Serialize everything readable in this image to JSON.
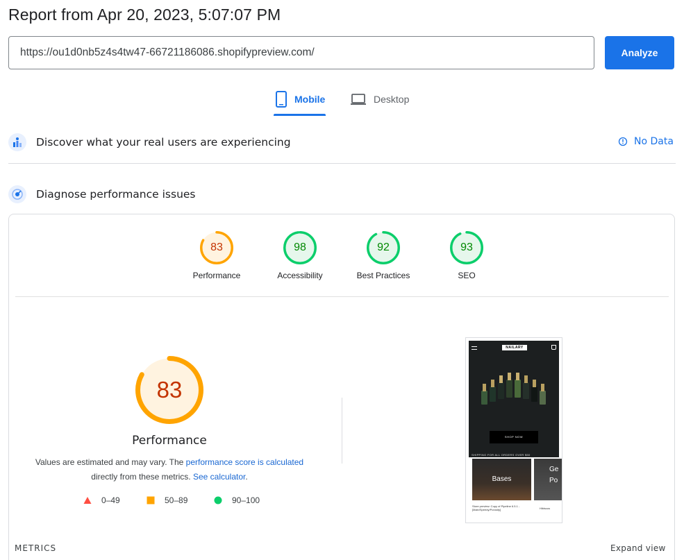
{
  "header": {
    "title": "Report from Apr 20, 2023, 5:07:07 PM",
    "url_value": "https://ou1d0nb5z4s4tw47-66721186086.shopifypreview.com/",
    "analyze_label": "Analyze"
  },
  "tabs": [
    {
      "label": "Mobile",
      "selected": true,
      "icon": "mobile-phone-icon"
    },
    {
      "label": "Desktop",
      "selected": false,
      "icon": "laptop-icon"
    }
  ],
  "field_data": {
    "title": "Discover what your real users are experiencing",
    "status_label": "No Data",
    "status_icon": "info-icon"
  },
  "lab_data": {
    "title": "Diagnose performance issues"
  },
  "scores": [
    {
      "label": "Performance",
      "value": 83,
      "color": "#ffa400",
      "text_color": "#c33300",
      "bg": "#fff3e0"
    },
    {
      "label": "Accessibility",
      "value": 98,
      "color": "#0cce6b",
      "text_color": "#008800",
      "bg": "#e6f7ec"
    },
    {
      "label": "Best Practices",
      "value": 92,
      "color": "#0cce6b",
      "text_color": "#008800",
      "bg": "#e6f7ec"
    },
    {
      "label": "SEO",
      "value": 93,
      "color": "#0cce6b",
      "text_color": "#008800",
      "bg": "#e6f7ec"
    }
  ],
  "performance": {
    "value": 83,
    "title": "Performance",
    "note_prefix": "Values are estimated and may vary. The ",
    "note_link1": "performance score is calculated",
    "note_middle": "directly from these metrics.",
    "note_link2": "See calculator",
    "note_suffix": "."
  },
  "legend": [
    {
      "shape": "triangle",
      "color": "#ff4e42",
      "label": "0–49"
    },
    {
      "shape": "square",
      "color": "#ffa400",
      "label": "50–89"
    },
    {
      "shape": "circle",
      "color": "#0cce6b",
      "label": "90–100"
    }
  ],
  "preview": {
    "brand": "NAILARY",
    "shop_now": "SHOP NOW",
    "shipping": "SHIPPING FOR ALL ORDERS OVER $50",
    "tile1": "Bases",
    "tile2_line1": "Ge",
    "tile2_line2": "Po",
    "caption1": "Store preview: Copy of Pipeline 6.5.1 - [Main/Speedy/Porosity]",
    "caption2": "Hibiscus"
  },
  "footer": {
    "metrics_label": "METRICS",
    "expand_label": "Expand view"
  }
}
